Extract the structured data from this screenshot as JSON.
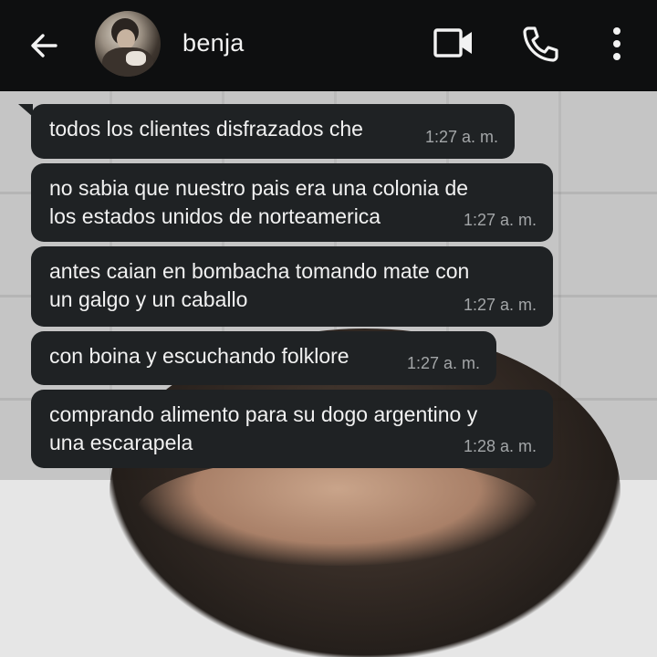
{
  "header": {
    "contact_name": "benja",
    "back_icon": "arrow-left-icon",
    "video_icon": "video-camera-icon",
    "call_icon": "phone-icon",
    "menu_icon": "more-vertical-icon"
  },
  "messages": [
    {
      "text": "todos los clientes disfrazados che",
      "time": "1:27 a. m."
    },
    {
      "text": "no sabia que nuestro pais era una colonia de\nlos estados unidos de norteamerica",
      "time": "1:27 a. m."
    },
    {
      "text": "antes caian en bombacha tomando mate con\nun galgo y un caballo",
      "time": "1:27 a. m."
    },
    {
      "text": "con boina y escuchando folklore",
      "time": "1:27 a. m."
    },
    {
      "text": "comprando alimento para su dogo argentino y\nuna escarapela",
      "time": "1:28 a. m."
    }
  ],
  "colors": {
    "header_bg": "#0e0f10",
    "bubble_bg": "#1f2224",
    "text": "#f1f1f1",
    "time": "#a3a6a8"
  }
}
